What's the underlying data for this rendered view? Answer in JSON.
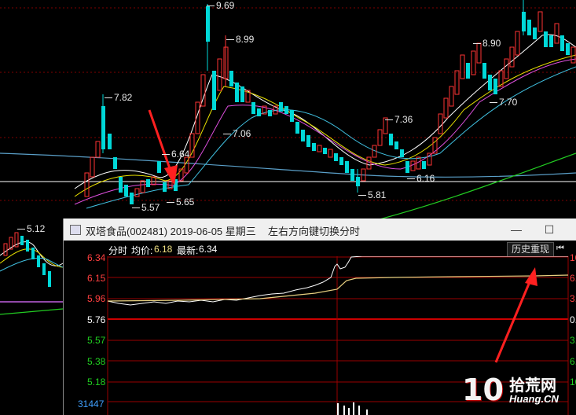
{
  "background_chart": {
    "price_labels": [
      "9.69",
      "8.99",
      "7.82",
      "7.06",
      "6.64",
      "5.57",
      "5.65",
      "7.36",
      "5.81",
      "6.16",
      "8.90",
      "7.70",
      "5.12"
    ]
  },
  "window": {
    "title": "双塔食品(002481) 2019-06-05 星期三",
    "hint": "左右方向键切换分时",
    "minimize_label": "—",
    "maximize_label": "☐",
    "info_tab": "分时",
    "avg_label": "均价:",
    "avg_value": "6.18",
    "latest_label": "最新:",
    "latest_value": "6.34",
    "history_button": "历史重现",
    "history_icon": "⏮",
    "y_axis_left": [
      "6.34",
      "6.15",
      "5.96",
      "5.76",
      "5.57",
      "5.38",
      "5.18"
    ],
    "y_axis_right": [
      "10",
      "6.",
      "3.",
      "0.",
      "3.",
      "6.",
      "10"
    ],
    "volume_label": "31447"
  },
  "watermark": {
    "logo": "10",
    "cn_text": "拾荒网",
    "en_text": "Huang.CN"
  },
  "colors": {
    "up": "#ff3333",
    "down": "#00d8d8",
    "grid_red": "#9a0000",
    "price_line": "#ffffff",
    "avg_line": "#e8d080",
    "arrow": "#ff2020"
  }
}
